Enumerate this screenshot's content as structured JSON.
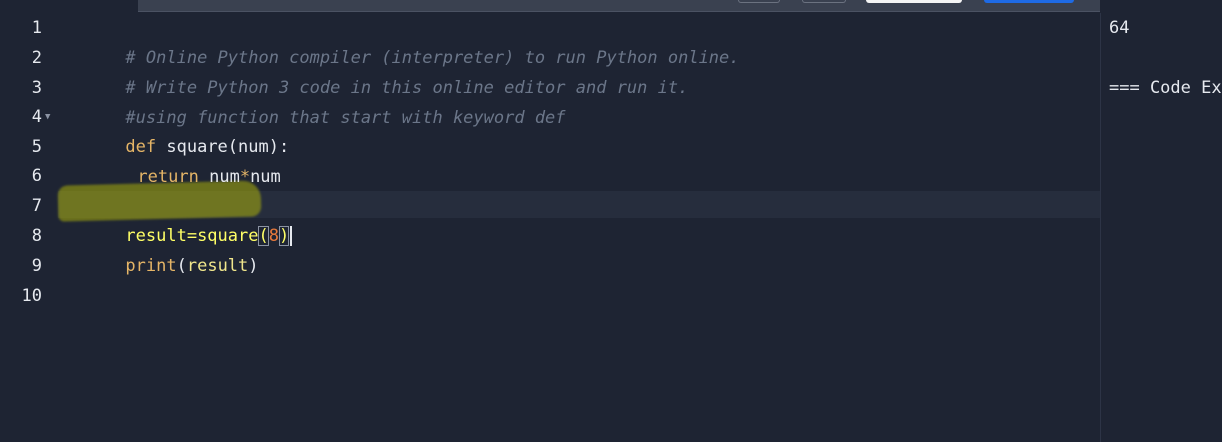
{
  "editor": {
    "line_numbers": [
      "1",
      "2",
      "3",
      "4",
      "5",
      "6",
      "7",
      "8",
      "9",
      "10"
    ],
    "lines": {
      "l1": "# Online Python compiler (interpreter) to run Python online.",
      "l2": "# Write Python 3 code in this online editor and run it.",
      "l3": "#using function that start with keyword def",
      "l4_kw": "def",
      "l4_rest": " square(num):",
      "l5_kw": "return",
      "l5_a": "num",
      "l5_op": "*",
      "l5_b": "num",
      "l7_a": "result=square",
      "l7_open": "(",
      "l7_num": "8",
      "l7_close": ")",
      "l8_fn": "print",
      "l8_open": "(",
      "l8_arg": "result",
      "l8_close": ")"
    },
    "fold_icon": "triangle-down-icon"
  },
  "output": {
    "line1": "64",
    "line2": "=== Code Execution Successful ==="
  },
  "colors": {
    "background": "#1e2433",
    "comment": "#6b7689",
    "keyword": "#e5b567",
    "number": "#e8793b",
    "highlight": "#c8cd00"
  }
}
